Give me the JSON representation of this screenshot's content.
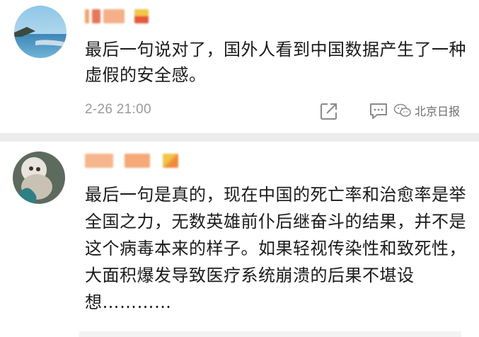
{
  "comments": [
    {
      "text": "最后一句说对了，国外人看到中国数据产生了一种虚假的安全感。",
      "time": "2-26 21:00"
    },
    {
      "text": "最后一句是真的，现在中国的死亡率和治愈率是举全国之力，无数英雄前仆后继奋斗的结果，并不是这个病毒本来的样子。如果轻视传染性和致死性，大面积爆发导致医疗系统崩溃的后果不堪设想…………"
    }
  ],
  "watermark": {
    "text": "北京日报"
  },
  "icons": {
    "share": "share-icon",
    "comment": "comment-icon",
    "wechat": "wechat-icon"
  },
  "colors": {
    "text": "#1a1a1a",
    "meta": "#9a9a9a",
    "divider": "#ececec",
    "blur_orange": "#f4a36c",
    "blur_red": "#e65a3a",
    "blur_yellow": "#f2c64a"
  }
}
